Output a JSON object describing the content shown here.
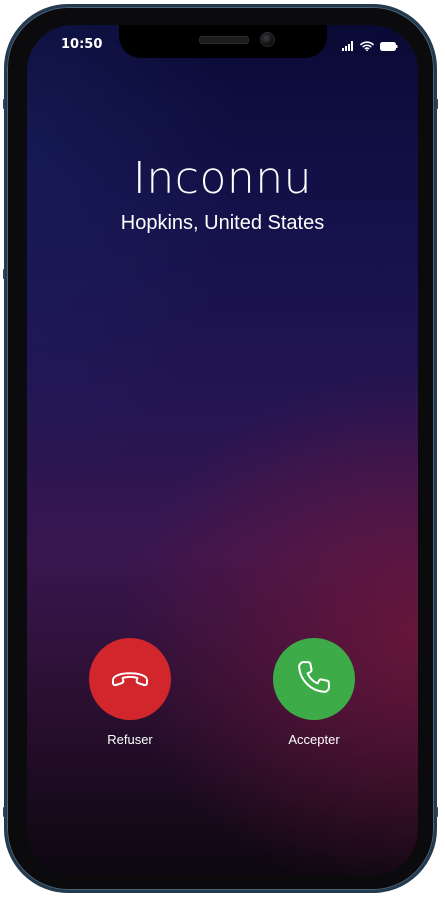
{
  "status_bar": {
    "time": "10:50",
    "icons": [
      "cellular-signal-icon",
      "wifi-icon",
      "battery-icon"
    ]
  },
  "call": {
    "caller_name": "Inconnu",
    "caller_location": "Hopkins, United States"
  },
  "actions": {
    "decline": {
      "label": "Refuser",
      "icon": "phone-hangup-icon",
      "color": "#d2262d"
    },
    "accept": {
      "label": "Accepter",
      "icon": "phone-answer-icon",
      "color": "#3dac48"
    }
  },
  "colors": {
    "frame": "#243a4f",
    "background_top": "#0a0a35",
    "background_glow": "#70163a"
  }
}
